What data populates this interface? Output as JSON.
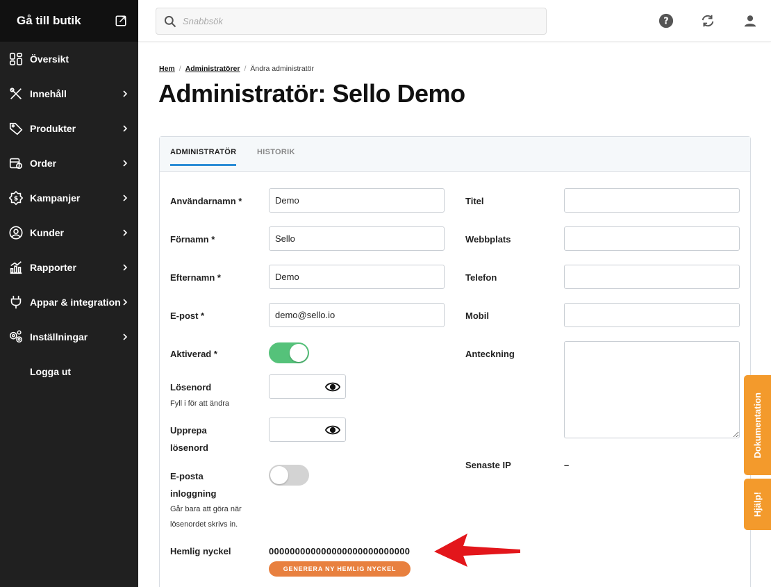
{
  "sidebar": {
    "store_link": "Gå till butik",
    "items": [
      {
        "label": "Översikt"
      },
      {
        "label": "Innehåll"
      },
      {
        "label": "Produkter"
      },
      {
        "label": "Order"
      },
      {
        "label": "Kampanjer"
      },
      {
        "label": "Kunder"
      },
      {
        "label": "Rapporter"
      },
      {
        "label": "Appar & integration"
      },
      {
        "label": "Inställningar"
      }
    ],
    "logout": "Logga ut"
  },
  "header": {
    "search_placeholder": "Snabbsök",
    "icons": [
      "help-icon",
      "sync-icon",
      "user-icon"
    ]
  },
  "breadcrumb": {
    "home": "Hem",
    "admins": "Administratörer",
    "current": "Ändra administratör"
  },
  "page_title": "Administratör: Sello Demo",
  "tabs": {
    "admin": "ADMINISTRATÖR",
    "history": "HISTORIK"
  },
  "form": {
    "username_label": "Användarnamn *",
    "username_value": "Demo",
    "firstname_label": "Förnamn *",
    "firstname_value": "Sello",
    "lastname_label": "Efternamn *",
    "lastname_value": "Demo",
    "email_label": "E-post *",
    "email_value": "demo@sello.io",
    "activated_label": "Aktiverad *",
    "activated": true,
    "password_label": "Lösenord",
    "password_hint": "Fyll i för att ändra",
    "repeat_password_label_1": "Upprepa",
    "repeat_password_label_2": "lösenord",
    "email_login_label_1": "E-posta",
    "email_login_label_2": "inloggning",
    "email_login_hint_1": "Går bara att göra när",
    "email_login_hint_2": "lösenordet skrivs in.",
    "email_login": false,
    "secret_key_label": "Hemlig nyckel",
    "secret_key_value": "000000000000000000000000000",
    "generate_button": "GENERERA NY HEMLIG NYCKEL",
    "title_label": "Titel",
    "title_value": "",
    "website_label": "Webbplats",
    "website_value": "",
    "phone_label": "Telefon",
    "phone_value": "",
    "mobile_label": "Mobil",
    "mobile_value": "",
    "note_label": "Anteckning",
    "note_value": "",
    "last_ip_label": "Senaste IP",
    "last_ip_value": "–"
  },
  "side_tabs": {
    "docs": "Dokumentation",
    "help": "Hjälp!"
  },
  "colors": {
    "sidebar_bg": "#202020",
    "accent_blue": "#2c8dd6",
    "toggle_on": "#55c27a",
    "orange_button": "#e8803f",
    "side_tab": "#f39a2c",
    "annotation_arrow": "#e3161b"
  }
}
